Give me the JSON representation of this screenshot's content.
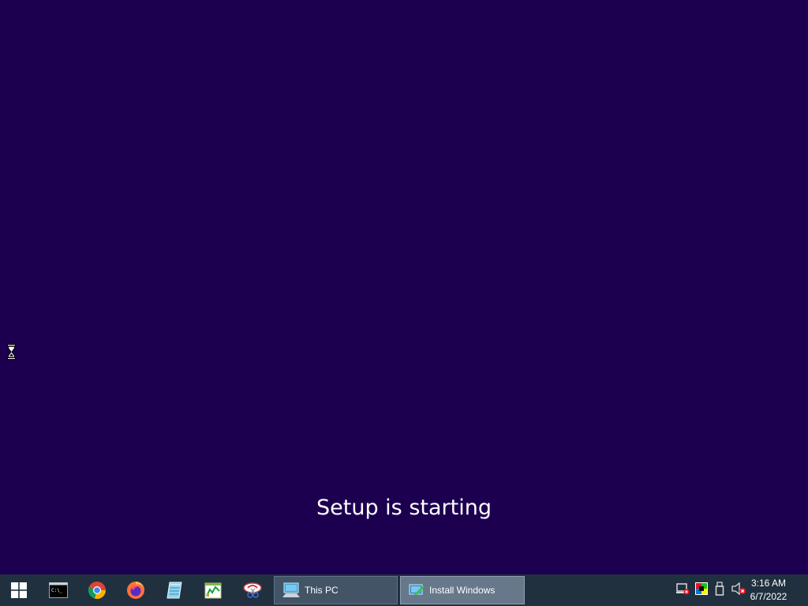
{
  "setup": {
    "message": "Setup is starting"
  },
  "taskbar": {
    "start_icon": "windows-logo-icon",
    "pinned": [
      {
        "name": "command-prompt-icon"
      },
      {
        "name": "chrome-icon"
      },
      {
        "name": "firefox-icon"
      },
      {
        "name": "notepad-icon"
      },
      {
        "name": "resource-monitor-icon"
      },
      {
        "name": "snipping-tool-icon"
      }
    ],
    "tasks": [
      {
        "label": "This PC",
        "icon": "this-pc-icon"
      },
      {
        "label": "Install Windows",
        "icon": "install-windows-icon"
      }
    ],
    "tray_icons": [
      "network-disconnected-icon",
      "display-color-icon",
      "usb-drive-icon",
      "volume-muted-icon"
    ],
    "clock": {
      "time": "3:16 AM",
      "date": "6/7/2022"
    }
  },
  "colors": {
    "desktop_bg": "#1c004f",
    "taskbar_bg": "#20303f",
    "active_task_bg": "#66788a"
  }
}
